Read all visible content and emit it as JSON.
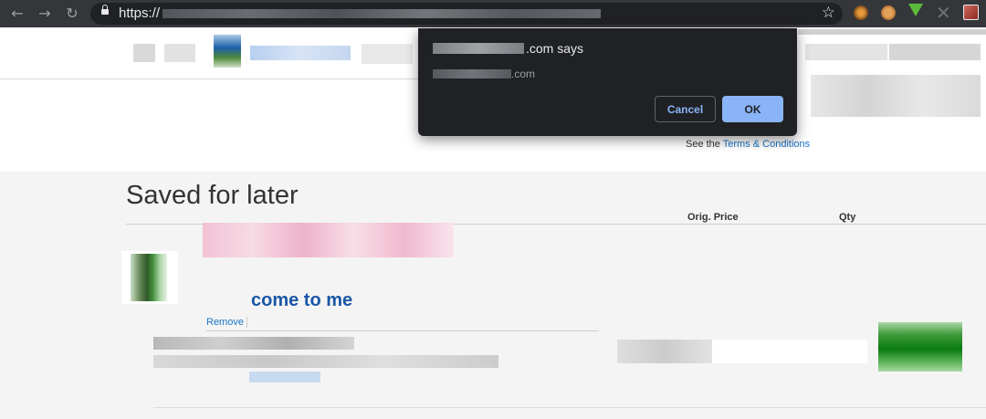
{
  "browser": {
    "back_icon": "arrow-left-icon",
    "forward_icon": "arrow-right-icon",
    "reload_icon": "reload-icon",
    "url_scheme": "https://",
    "bookmark_icon": "star-icon",
    "extensions": [
      "extension-1-icon",
      "cookie-icon",
      "download-arrow-icon",
      "x-extension-icon",
      "profile-icon"
    ]
  },
  "page": {
    "terms_prefix": "See the ",
    "terms_link": "Terms & Conditions",
    "saved_title": "Saved for later",
    "col_orig_price": "Orig. Price",
    "col_qty": "Qty",
    "item": {
      "injected_text": "come to me",
      "remove_label": "Remove"
    }
  },
  "dialog": {
    "title_suffix": ".com says",
    "message_suffix": ".com",
    "cancel_label": "Cancel",
    "ok_label": "OK"
  },
  "colors": {
    "toolbar_bg": "#35363a",
    "dialog_bg": "#202124",
    "ok_button": "#8ab4f8",
    "link": "#1a73c8",
    "injected_text": "#1a56a8"
  }
}
